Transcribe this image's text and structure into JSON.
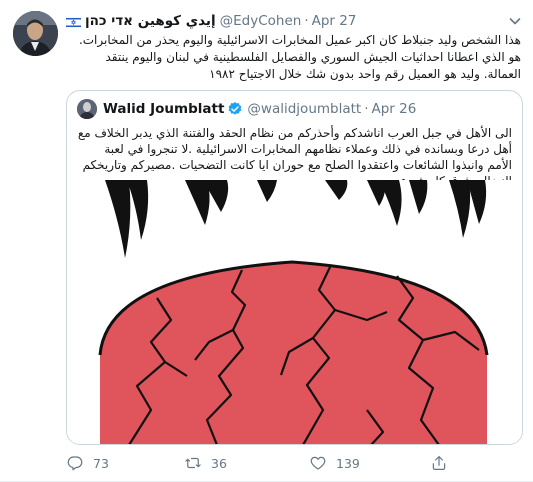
{
  "tweet": {
    "author": {
      "display_name": "إيدي كوهين אדי כהן",
      "handle": "@EdyCohen",
      "separator": "·",
      "date": "Apr 27"
    },
    "text": "هذا الشخص وليد جنبلاط كان اكبر عميل المخابرات الاسرائيلية واليوم يحذر من المخابرات. هو الذي اعطانا احداثيات الجيش السوري والفصايل الفلسطينية في لبنان واليوم ينتقد العمالة. وليد هو العميل رقم واحد بدون شك خلال الاجتياح ١٩٨٢"
  },
  "quoted_tweet": {
    "author": {
      "display_name": "Walid Joumblatt",
      "handle": "@walidjoumblatt",
      "separator": "·",
      "date": "Apr 26"
    },
    "text": "الى الأهل في جبل العرب اناشدكم وأحذركم من نظام الحقد والفتنة الذي يدبر الخلاف مع أهل درعا وبسانده في ذلك وعملاء نظامهم المخابرات الاسرائيلية .لا تنجروا في لعبة الأمم وانبذوا الشائعات واعتقدوا الصلح مع حوران ايا كانت التضحيات .مصيركم وتاريخكم النضالي فوق كل شيء"
  },
  "actions": {
    "reply_count": "73",
    "retweet_count": "36",
    "like_count": "139"
  },
  "icons": [
    "israel-flag-icon",
    "chevron-down-icon",
    "verified-badge-icon",
    "reply-icon",
    "retweet-icon",
    "like-icon",
    "share-icon"
  ],
  "colors": {
    "verified": "#1da1f2",
    "secondary_text": "#657786",
    "globe_red": "#e0545c"
  }
}
